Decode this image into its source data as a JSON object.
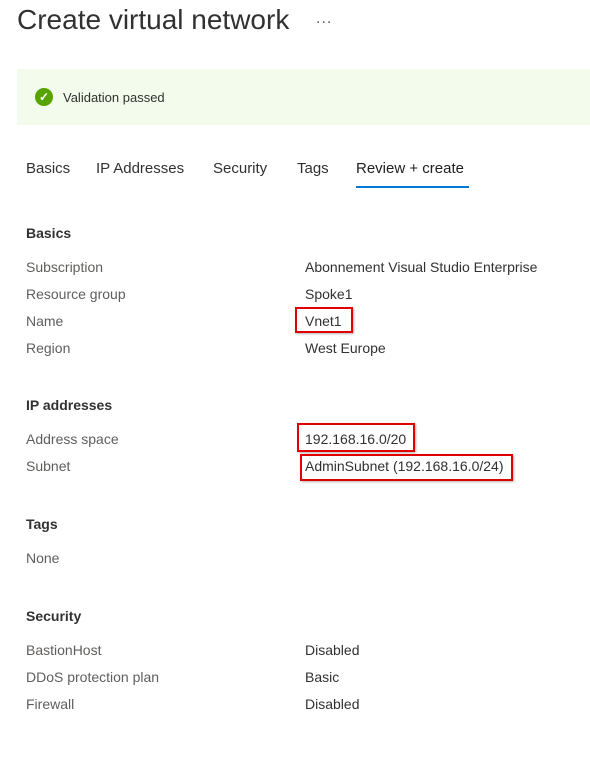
{
  "header": {
    "title": "Create virtual network",
    "more": "..."
  },
  "banner": {
    "text": "Validation passed",
    "icon": "check-circle-icon",
    "color": "#57a300"
  },
  "tabs": [
    {
      "label": "Basics"
    },
    {
      "label": "IP Addresses"
    },
    {
      "label": "Security"
    },
    {
      "label": "Tags"
    },
    {
      "label": "Review + create",
      "active": true
    }
  ],
  "basics": {
    "title": "Basics",
    "rows": [
      {
        "label": "Subscription",
        "value": "Abonnement Visual Studio Enterprise"
      },
      {
        "label": "Resource group",
        "value": "Spoke1"
      },
      {
        "label": "Name",
        "value": "Vnet1"
      },
      {
        "label": "Region",
        "value": "West Europe"
      }
    ]
  },
  "ip": {
    "title": "IP addresses",
    "rows": [
      {
        "label": "Address space",
        "value": "192.168.16.0/20"
      },
      {
        "label": "Subnet",
        "value": "AdminSubnet (192.168.16.0/24)"
      }
    ]
  },
  "tags": {
    "title": "Tags",
    "value": "None"
  },
  "security": {
    "title": "Security",
    "rows": [
      {
        "label": "BastionHost",
        "value": "Disabled"
      },
      {
        "label": "DDoS protection plan",
        "value": "Basic"
      },
      {
        "label": "Firewall",
        "value": "Disabled"
      }
    ]
  }
}
